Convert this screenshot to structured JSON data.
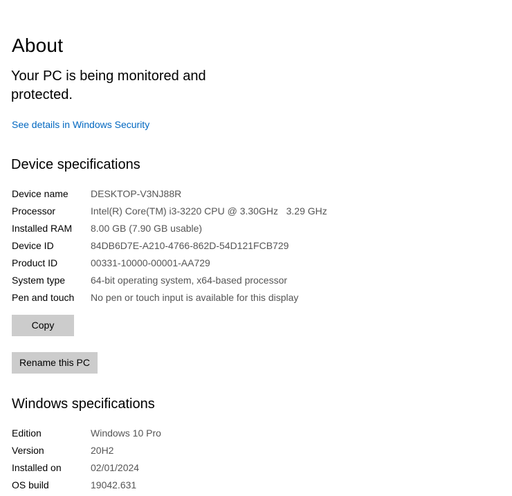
{
  "page": {
    "title": "About"
  },
  "security": {
    "status": "Your PC is being monitored and protected.",
    "link": "See details in Windows Security"
  },
  "device_specs": {
    "heading": "Device specifications",
    "rows": [
      {
        "label": "Device name",
        "value": "DESKTOP-V3NJ88R"
      },
      {
        "label": "Processor",
        "value": "Intel(R) Core(TM) i3-3220 CPU @ 3.30GHz   3.29 GHz"
      },
      {
        "label": "Installed RAM",
        "value": "8.00 GB (7.90 GB usable)"
      },
      {
        "label": "Device ID",
        "value": "84DB6D7E-A210-4766-862D-54D121FCB729"
      },
      {
        "label": "Product ID",
        "value": "00331-10000-00001-AA729"
      },
      {
        "label": "System type",
        "value": "64-bit operating system, x64-based processor"
      },
      {
        "label": "Pen and touch",
        "value": "No pen or touch input is available for this display"
      }
    ],
    "copy_button": "Copy",
    "rename_button": "Rename this PC"
  },
  "windows_specs": {
    "heading": "Windows specifications",
    "rows": [
      {
        "label": "Edition",
        "value": "Windows 10 Pro"
      },
      {
        "label": "Version",
        "value": "20H2"
      },
      {
        "label": "Installed on",
        "value": "02/01/2024"
      },
      {
        "label": "OS build",
        "value": "19042.631"
      }
    ]
  },
  "colors": {
    "link": "#0067c0",
    "button_bg": "#cccccc",
    "value_text": "#555555"
  }
}
